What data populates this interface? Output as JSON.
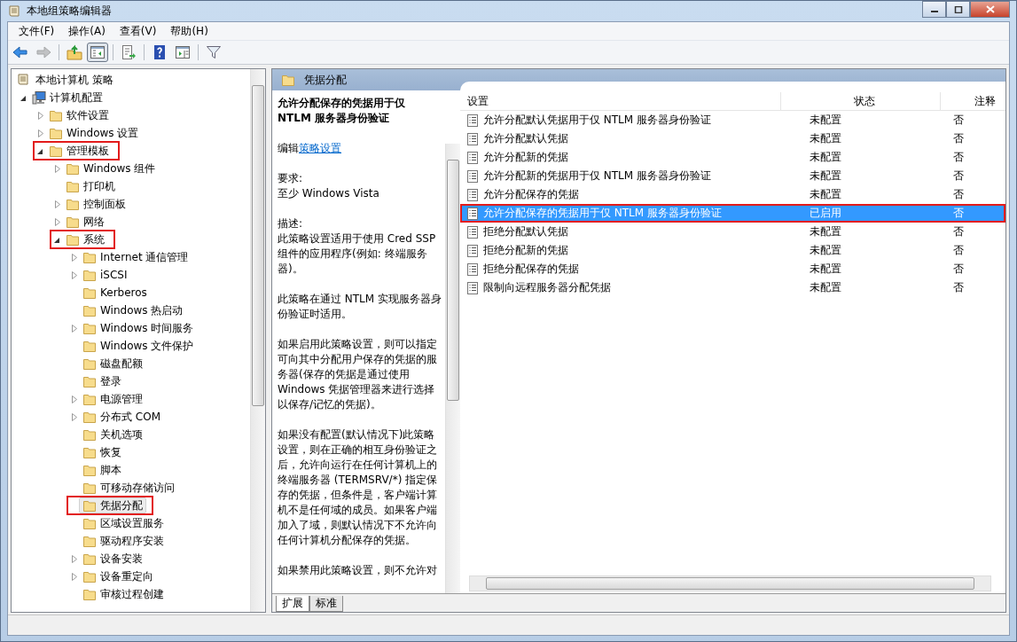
{
  "window": {
    "title": "本地组策略编辑器"
  },
  "menu": [
    {
      "label": "文件(F)"
    },
    {
      "label": "操作(A)"
    },
    {
      "label": "查看(V)"
    },
    {
      "label": "帮助(H)"
    }
  ],
  "toolbar": [
    {
      "kind": "back",
      "disabled": false,
      "pressed": false
    },
    {
      "kind": "forward",
      "disabled": true,
      "pressed": false
    },
    {
      "kind": "sep"
    },
    {
      "kind": "up",
      "disabled": false,
      "pressed": false
    },
    {
      "kind": "tree",
      "disabled": false,
      "pressed": true
    },
    {
      "kind": "sep"
    },
    {
      "kind": "export",
      "disabled": false,
      "pressed": false
    },
    {
      "kind": "sep"
    },
    {
      "kind": "help",
      "disabled": false,
      "pressed": false
    },
    {
      "kind": "pane",
      "disabled": false,
      "pressed": false
    },
    {
      "kind": "sep"
    },
    {
      "kind": "filter",
      "disabled": false,
      "pressed": false
    }
  ],
  "tree": {
    "label": "本地计算机 策略",
    "children": [
      {
        "label": "计算机配置",
        "kind": "computer",
        "expanded": true,
        "selected": false,
        "highlighted": false,
        "children": [
          {
            "label": "软件设置",
            "kind": "folder",
            "expanded": false,
            "selected": false,
            "highlighted": false
          },
          {
            "label": "Windows 设置",
            "kind": "folder",
            "expanded": false,
            "selected": false,
            "highlighted": false
          },
          {
            "label": "管理模板",
            "kind": "folder",
            "expanded": true,
            "selected": false,
            "highlighted": true,
            "children": [
              {
                "label": "Windows 组件",
                "kind": "folder",
                "expanded": false,
                "selected": false,
                "highlighted": false
              },
              {
                "label": "打印机",
                "kind": "folder",
                "selected": false,
                "highlighted": false
              },
              {
                "label": "控制面板",
                "kind": "folder",
                "expanded": false,
                "selected": false,
                "highlighted": false
              },
              {
                "label": "网络",
                "kind": "folder",
                "expanded": false,
                "selected": false,
                "highlighted": false
              },
              {
                "label": "系统",
                "kind": "folder",
                "expanded": true,
                "selected": false,
                "highlighted": true,
                "children": [
                  {
                    "label": "Internet 通信管理",
                    "kind": "folder",
                    "expanded": false,
                    "selected": false,
                    "highlighted": false
                  },
                  {
                    "label": "iSCSI",
                    "kind": "folder",
                    "expanded": false,
                    "selected": false,
                    "highlighted": false
                  },
                  {
                    "label": "Kerberos",
                    "kind": "folder",
                    "selected": false,
                    "highlighted": false
                  },
                  {
                    "label": "Windows 热启动",
                    "kind": "folder",
                    "selected": false,
                    "highlighted": false
                  },
                  {
                    "label": "Windows 时间服务",
                    "kind": "folder",
                    "expanded": false,
                    "selected": false,
                    "highlighted": false
                  },
                  {
                    "label": "Windows 文件保护",
                    "kind": "folder",
                    "selected": false,
                    "highlighted": false
                  },
                  {
                    "label": "磁盘配额",
                    "kind": "folder",
                    "selected": false,
                    "highlighted": false
                  },
                  {
                    "label": "登录",
                    "kind": "folder",
                    "selected": false,
                    "highlighted": false
                  },
                  {
                    "label": "电源管理",
                    "kind": "folder",
                    "expanded": false,
                    "selected": false,
                    "highlighted": false
                  },
                  {
                    "label": "分布式 COM",
                    "kind": "folder",
                    "expanded": false,
                    "selected": false,
                    "highlighted": false
                  },
                  {
                    "label": "关机选项",
                    "kind": "folder",
                    "selected": false,
                    "highlighted": false
                  },
                  {
                    "label": "恢复",
                    "kind": "folder",
                    "selected": false,
                    "highlighted": false
                  },
                  {
                    "label": "脚本",
                    "kind": "folder",
                    "selected": false,
                    "highlighted": false
                  },
                  {
                    "label": "可移动存储访问",
                    "kind": "folder",
                    "selected": false,
                    "highlighted": false
                  },
                  {
                    "label": "凭据分配",
                    "kind": "folder",
                    "selected": true,
                    "highlighted": true
                  },
                  {
                    "label": "区域设置服务",
                    "kind": "folder",
                    "selected": false,
                    "highlighted": false
                  },
                  {
                    "label": "驱动程序安装",
                    "kind": "folder",
                    "selected": false,
                    "highlighted": false
                  },
                  {
                    "label": "设备安装",
                    "kind": "folder",
                    "expanded": false,
                    "selected": false,
                    "highlighted": false
                  },
                  {
                    "label": "设备重定向",
                    "kind": "folder",
                    "expanded": false,
                    "selected": false,
                    "highlighted": false
                  },
                  {
                    "label": "审核过程创建",
                    "kind": "folder",
                    "selected": false,
                    "highlighted": false
                  }
                ]
              }
            ]
          }
        ]
      }
    ]
  },
  "panel": {
    "title": "凭据分配"
  },
  "description": {
    "title": "允许分配保存的凭据用于仅 NTLM 服务器身份验证",
    "edit_prefix": "编辑",
    "edit_link": "策略设置",
    "requirements_label": "要求:",
    "requirements": "至少 Windows Vista",
    "description_label": "描述:",
    "paragraphs": [
      "此策略设置适用于使用 Cred SSP 组件的应用程序(例如: 终端服务器)。",
      "此策略在通过 NTLM 实现服务器身份验证时适用。",
      "如果启用此策略设置，则可以指定可向其中分配用户保存的凭据的服务器(保存的凭据是通过使用 Windows 凭据管理器来进行选择以保存/记忆的凭据)。",
      "如果没有配置(默认情况下)此策略设置，则在正确的相互身份验证之后，允许向运行在任何计算机上的终端服务器 (TERMSRV/*) 指定保存的凭据，但条件是，客户端计算机不是任何域的成员。如果客户端加入了域，则默认情况下不允许向任何计算机分配保存的凭据。",
      "如果禁用此策略设置，则不允许对"
    ]
  },
  "table": {
    "columns": [
      "设置",
      "状态",
      "注释"
    ],
    "rows": [
      {
        "setting": "允许分配默认凭据用于仅 NTLM 服务器身份验证",
        "state": "未配置",
        "comment": "否",
        "selected": false,
        "highlighted": false
      },
      {
        "setting": "允许分配默认凭据",
        "state": "未配置",
        "comment": "否",
        "selected": false,
        "highlighted": false
      },
      {
        "setting": "允许分配新的凭据",
        "state": "未配置",
        "comment": "否",
        "selected": false,
        "highlighted": false
      },
      {
        "setting": "允许分配新的凭据用于仅 NTLM 服务器身份验证",
        "state": "未配置",
        "comment": "否",
        "selected": false,
        "highlighted": false
      },
      {
        "setting": "允许分配保存的凭据",
        "state": "未配置",
        "comment": "否",
        "selected": false,
        "highlighted": false
      },
      {
        "setting": "允许分配保存的凭据用于仅 NTLM 服务器身份验证",
        "state": "已启用",
        "comment": "否",
        "selected": true,
        "highlighted": true
      },
      {
        "setting": "拒绝分配默认凭据",
        "state": "未配置",
        "comment": "否",
        "selected": false,
        "highlighted": false
      },
      {
        "setting": "拒绝分配新的凭据",
        "state": "未配置",
        "comment": "否",
        "selected": false,
        "highlighted": false
      },
      {
        "setting": "拒绝分配保存的凭据",
        "state": "未配置",
        "comment": "否",
        "selected": false,
        "highlighted": false
      },
      {
        "setting": "限制向远程服务器分配凭据",
        "state": "未配置",
        "comment": "否",
        "selected": false,
        "highlighted": false
      }
    ]
  },
  "tabs": [
    {
      "label": "扩展",
      "selected": true
    },
    {
      "label": "标准",
      "selected": false
    }
  ]
}
